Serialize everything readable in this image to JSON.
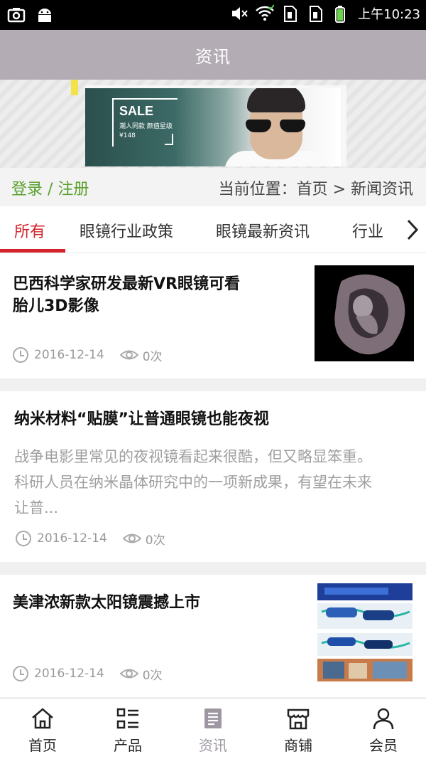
{
  "status_bar": {
    "time": "上午10:23",
    "icons": [
      "screenshot-icon",
      "android-icon",
      "mute-icon",
      "wifi-icon",
      "sim1-icon",
      "sim2-icon",
      "battery-icon"
    ]
  },
  "header": {
    "title": "资讯"
  },
  "banner": {
    "sale": "SALE",
    "subtitle": "潮人同款 颜值星级",
    "price_prefix": "¥148"
  },
  "infobar": {
    "login": "登录 / 注册",
    "breadcrumb": "当前位置：首页 > 新闻资讯"
  },
  "tabs": [
    {
      "label": "所有",
      "active": true
    },
    {
      "label": "眼镜行业政策",
      "active": false
    },
    {
      "label": "眼镜最新资讯",
      "active": false
    },
    {
      "label": "行业",
      "active": false
    }
  ],
  "articles": [
    {
      "title_line1": "巴西科学家研发最新VR眼镜可看",
      "title_line2": "胎儿3D影像",
      "date": "2016-12-14",
      "views": "0次",
      "has_thumb": true
    },
    {
      "title": "纳米材料“贴膜”让普通眼镜也能夜视",
      "desc_line1": "战争电影里常见的夜视镜看起来很酷，但又略显笨重。",
      "desc_line2": "科研人员在纳米晶体研究中的一项新成果，有望在未来",
      "desc_line3": "让普...",
      "date": "2016-12-14",
      "views": "0次",
      "has_thumb": false
    },
    {
      "title": "美津浓新款太阳镜震撼上市",
      "date": "2016-12-14",
      "views": "0次",
      "has_thumb": true
    }
  ],
  "bottom_nav": [
    {
      "label": "首页",
      "icon": "home-icon",
      "active": false
    },
    {
      "label": "产品",
      "icon": "list-icon",
      "active": false
    },
    {
      "label": "资讯",
      "icon": "document-icon",
      "active": true
    },
    {
      "label": "商铺",
      "icon": "store-icon",
      "active": false
    },
    {
      "label": "会员",
      "icon": "user-icon",
      "active": false
    }
  ],
  "colors": {
    "header_bg": "#b3acb5",
    "accent_red": "#d5232a",
    "login_green": "#5aa02c",
    "nav_active": "#9e97a2"
  }
}
